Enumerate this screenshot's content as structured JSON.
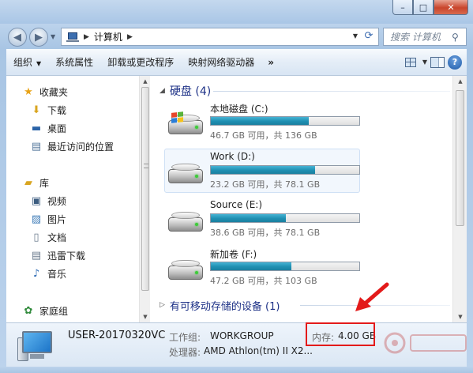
{
  "window": {
    "caption_min": "–",
    "caption_max": "□",
    "caption_close": "✕"
  },
  "address": {
    "path": "计算机",
    "search_placeholder": "搜索 计算机"
  },
  "toolbar": {
    "items": [
      "组织",
      "系统属性",
      "卸载或更改程序",
      "映射网络驱动器"
    ],
    "more": "»"
  },
  "nav": {
    "favorites": "收藏夹",
    "downloads": "下载",
    "desktop": "桌面",
    "recent": "最近访问的位置",
    "libraries": "库",
    "videos": "视频",
    "pictures": "图片",
    "documents": "文档",
    "xunlei": "迅雷下载",
    "music": "音乐",
    "homegroup": "家庭组"
  },
  "groups": {
    "hard_disks": "硬盘 (4)",
    "removable": "有可移动存储的设备 (1)"
  },
  "drives": [
    {
      "name": "本地磁盘 (C:)",
      "free_text": "46.7 GB 可用，共 136 GB",
      "used_fraction": 0.657,
      "bar_color": "#26a0c6"
    },
    {
      "name": "Work (D:)",
      "free_text": "23.2 GB 可用，共 78.1 GB",
      "used_fraction": 0.703,
      "bar_color": "#26a0c6"
    },
    {
      "name": "Source (E:)",
      "free_text": "38.6 GB 可用，共 78.1 GB",
      "used_fraction": 0.506,
      "bar_color": "#26a0c6"
    },
    {
      "name": "新加卷 (F:)",
      "free_text": "47.2 GB 可用，共 103 GB",
      "used_fraction": 0.542,
      "bar_color": "#26a0c6"
    }
  ],
  "details": {
    "computer_name": "USER-20170320VC",
    "workgroup_label": "工作组:",
    "workgroup_value": "WORKGROUP",
    "memory_label": "内存:",
    "memory_value": "4.00 GB",
    "processor_label": "处理器:",
    "processor_value": "AMD Athlon(tm) II X2..."
  },
  "colors": {
    "accent": "#1e3287",
    "highlight_annotation": "#e31a1a",
    "usage_bar": "#26a0c6"
  },
  "icons": {
    "favorites": "star-icon",
    "downloads": "download-folder-icon",
    "desktop": "desktop-icon",
    "recent": "recent-places-icon",
    "libraries": "library-icon",
    "videos": "video-icon",
    "pictures": "picture-icon",
    "documents": "document-icon",
    "xunlei": "download-folder-icon",
    "music": "music-note-icon",
    "homegroup": "homegroup-icon"
  }
}
